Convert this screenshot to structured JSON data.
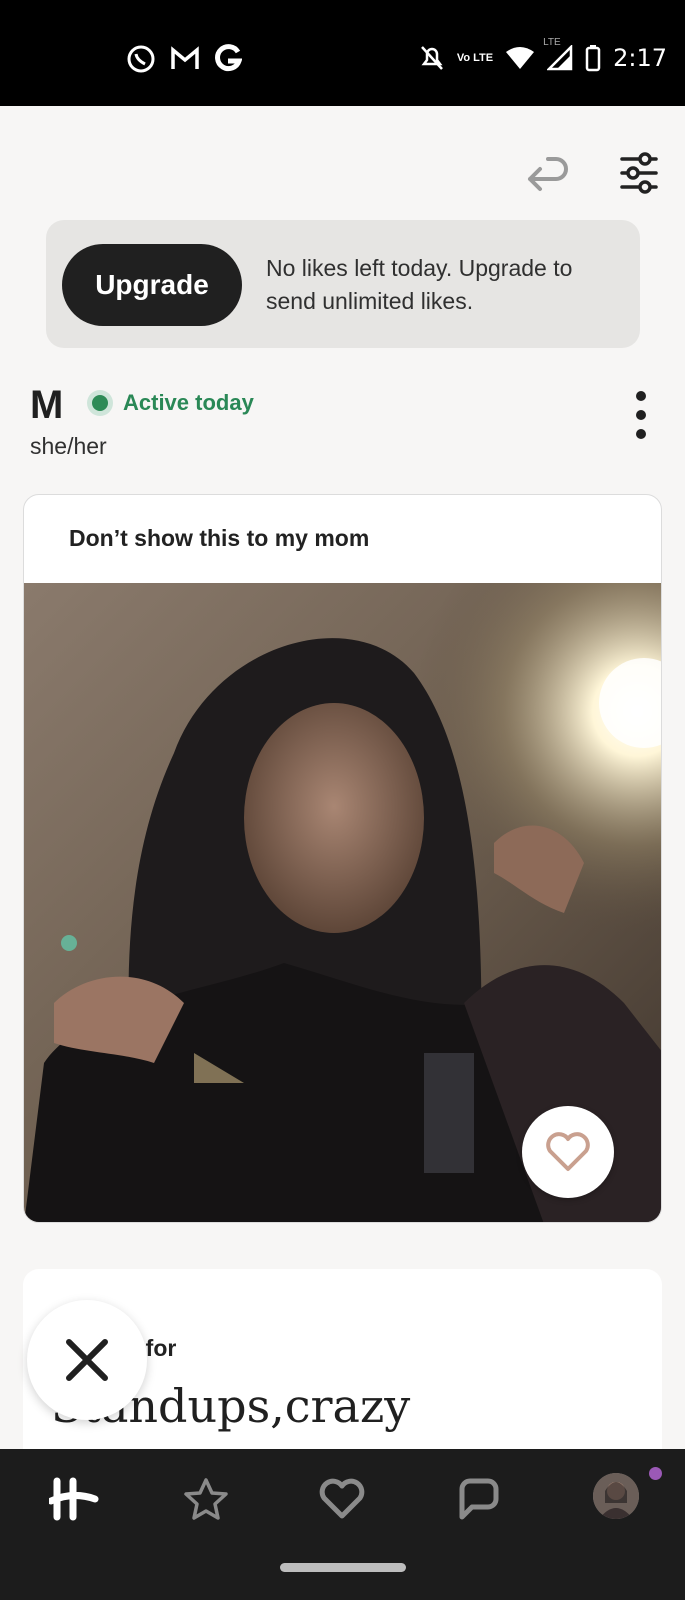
{
  "status_bar": {
    "time": "2:17",
    "network_label": "Vo LTE",
    "lte_label": "LTE",
    "app_icons": [
      "whatsapp-icon",
      "gmail-icon",
      "google-icon"
    ],
    "system_icons": [
      "silent-icon",
      "volte-icon",
      "wifi-icon",
      "signal-icon",
      "battery-icon"
    ]
  },
  "toolbar": {
    "undo_icon": "undo-icon",
    "filter_icon": "filter-icon"
  },
  "banner": {
    "button_label": "Upgrade",
    "message": "No likes left today. Upgrade to send unlimited likes."
  },
  "profile": {
    "name": "M",
    "status": "Active today",
    "pronouns": "she/her"
  },
  "prompt_card": {
    "prompt": "Don’t show this to my mom"
  },
  "second_card": {
    "prompt_partial": "zy for",
    "answer_partial": "Standups,crazy"
  },
  "bottom_nav": {
    "items": [
      "home-tab",
      "standouts-tab",
      "likes-tab",
      "matches-tab",
      "profile-tab"
    ]
  },
  "colors": {
    "accent_green": "#2a8856",
    "dark": "#202020",
    "nav_bg": "#1c1c1c",
    "notification_dot": "#9b59b6"
  }
}
